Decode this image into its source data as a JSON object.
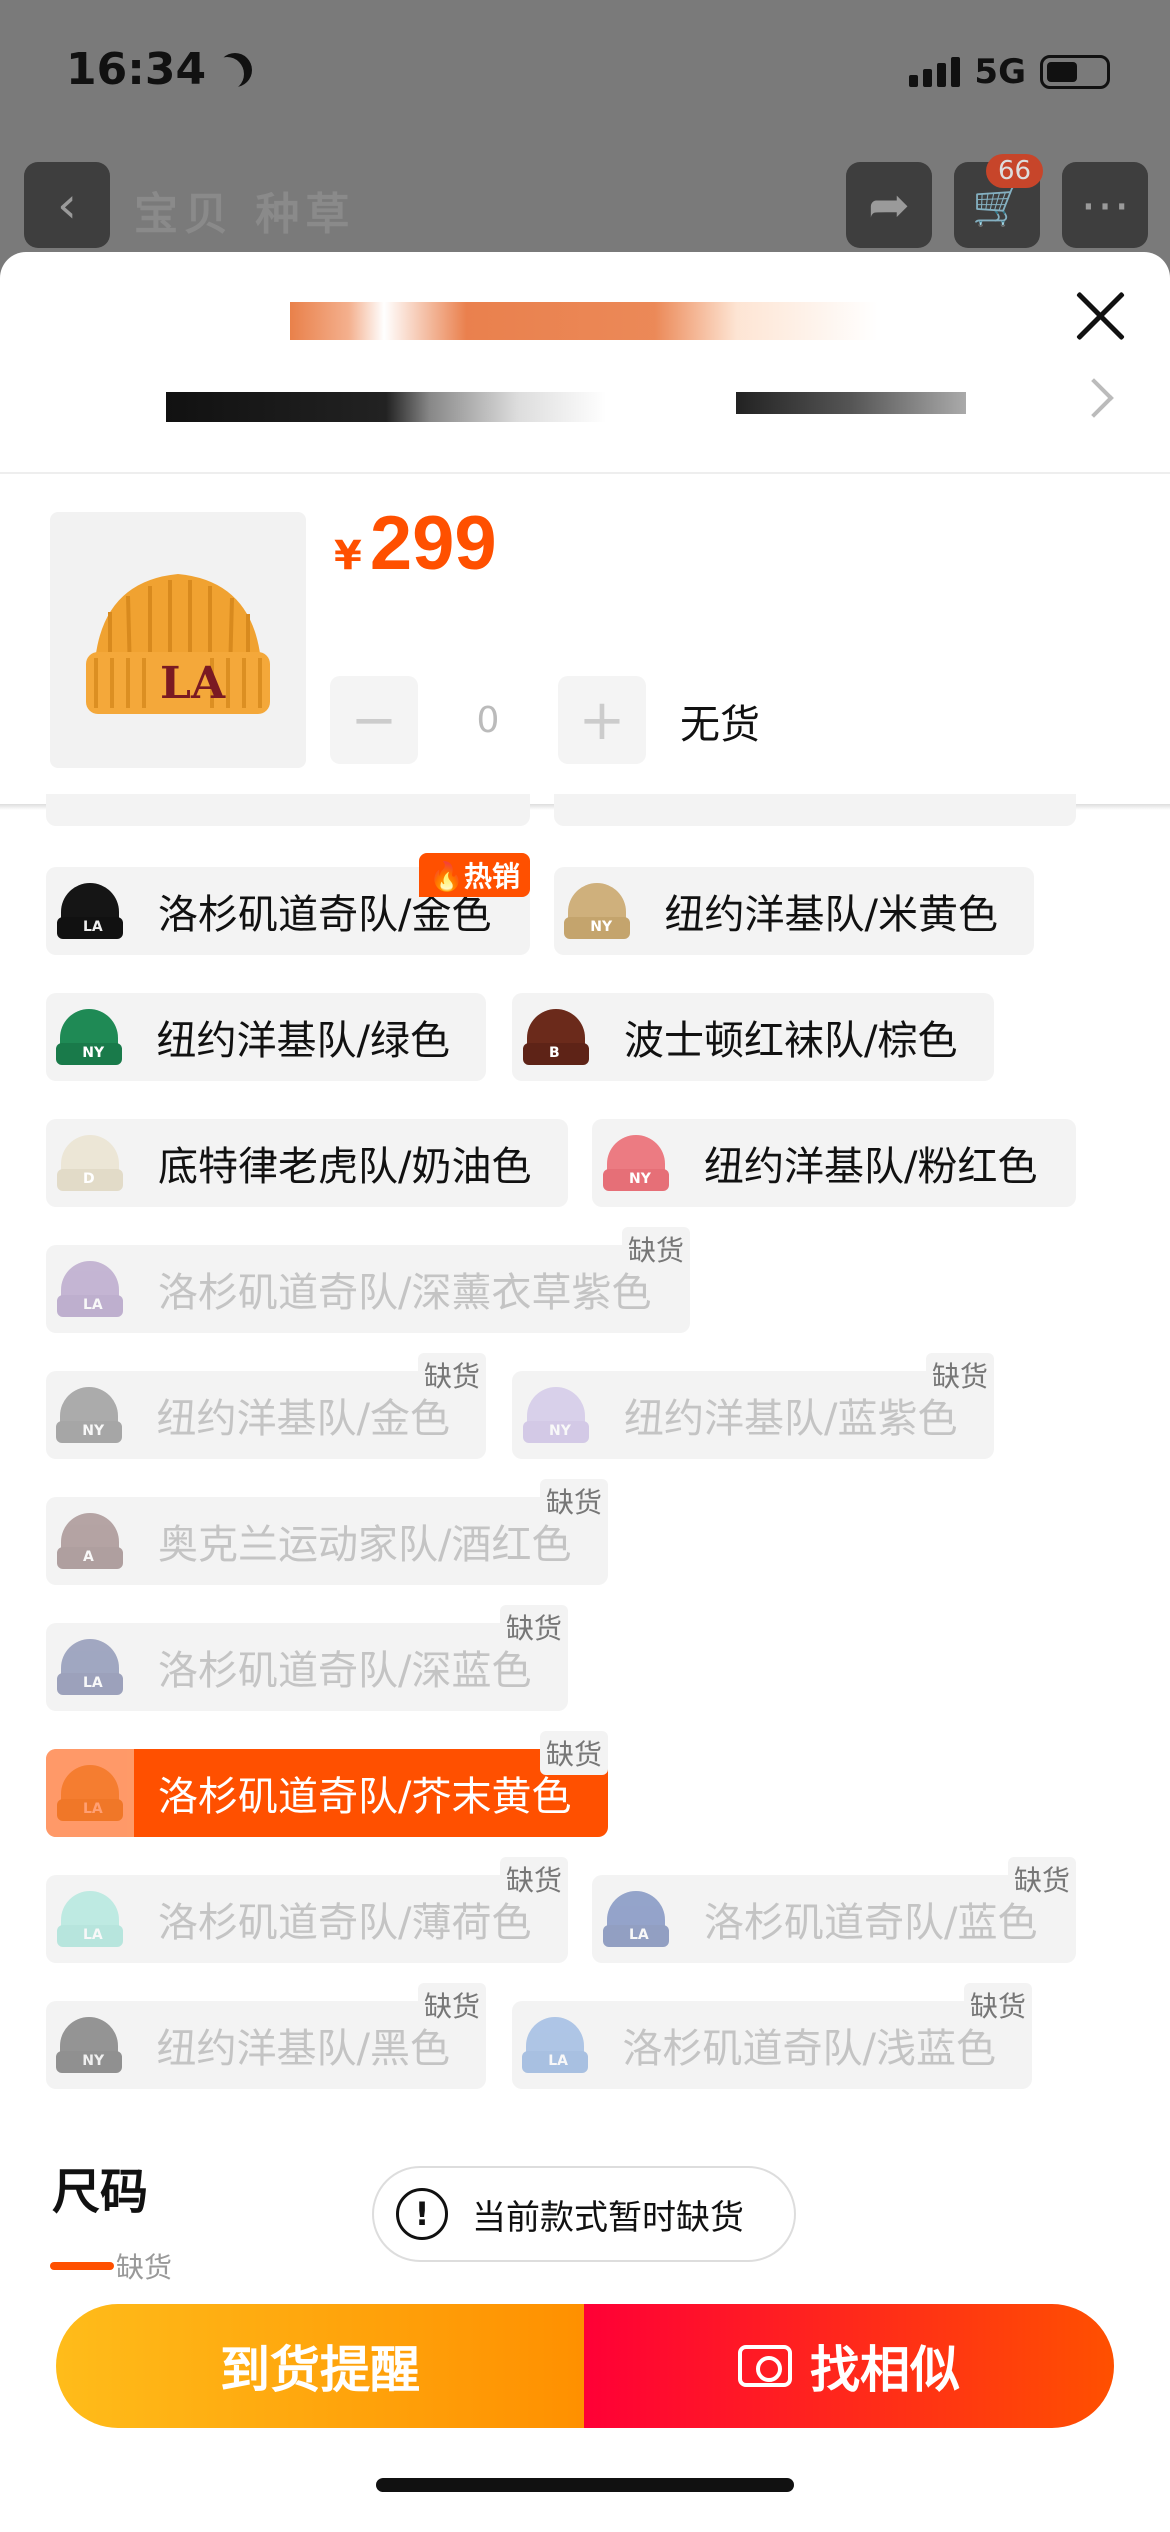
{
  "status_bar": {
    "time": "16:34",
    "network": "5G"
  },
  "background_nav": {
    "title": "宝贝  种草",
    "cart_count": "66"
  },
  "product": {
    "currency": "¥",
    "price": "299",
    "quantity": "0",
    "stock_status": "无货",
    "minus": "−",
    "plus": "+"
  },
  "options": [
    {
      "label": "洛杉矶道奇队/金色",
      "badge": "热销",
      "out_of_stock": false,
      "hat_color": "#151515",
      "cuff_color": "#111",
      "logo": "LA"
    },
    {
      "label": "纽约洋基队/米黄色",
      "badge": "",
      "out_of_stock": false,
      "hat_color": "#cfb07c",
      "cuff_color": "#c4a46d",
      "logo": "NY"
    },
    {
      "label": "纽约洋基队/绿色",
      "badge": "",
      "out_of_stock": false,
      "hat_color": "#1f8a55",
      "cuff_color": "#197a4a",
      "logo": "NY"
    },
    {
      "label": "波士顿红袜队/棕色",
      "badge": "",
      "out_of_stock": false,
      "hat_color": "#6b2a1b",
      "cuff_color": "#5e2317",
      "logo": "B"
    },
    {
      "label": "底特律老虎队/奶油色",
      "badge": "",
      "out_of_stock": false,
      "hat_color": "#ece6d6",
      "cuff_color": "#e2dbc8",
      "logo": "D"
    },
    {
      "label": "纽约洋基队/粉红色",
      "badge": "",
      "out_of_stock": false,
      "hat_color": "#ec7b82",
      "cuff_color": "#e66f77",
      "logo": "NY"
    },
    {
      "label": "洛杉矶道奇队/深薰衣草紫色",
      "badge": "缺货",
      "out_of_stock": true,
      "hat_color": "#8d6cae",
      "cuff_color": "#7f5fa2",
      "logo": "LA"
    },
    {
      "label": "纽约洋基队/金色",
      "badge": "缺货",
      "out_of_stock": true,
      "hat_color": "#555",
      "cuff_color": "#4a4a4a",
      "logo": "NY"
    },
    {
      "label": "纽约洋基队/蓝紫色",
      "badge": "缺货",
      "out_of_stock": true,
      "hat_color": "#b9a6e0",
      "cuff_color": "#ad98d8",
      "logo": "NY"
    },
    {
      "label": "奥克兰运动家队/酒红色",
      "badge": "缺货",
      "out_of_stock": true,
      "hat_color": "#6a4444",
      "cuff_color": "#5d3a3a",
      "logo": "A"
    },
    {
      "label": "洛杉矶道奇队/深蓝色",
      "badge": "缺货",
      "out_of_stock": true,
      "hat_color": "#3d4c86",
      "cuff_color": "#334078",
      "logo": "LA"
    },
    {
      "label": "洛杉矶道奇队/芥末黄色",
      "badge": "缺货",
      "out_of_stock": true,
      "selected": true,
      "hat_color": "#e9b46a",
      "cuff_color": "#e0a85a",
      "logo": "LA"
    },
    {
      "label": "洛杉矶道奇队/薄荷色",
      "badge": "缺货",
      "out_of_stock": true,
      "hat_color": "#7fe0cf",
      "cuff_color": "#70d6c4",
      "logo": "LA"
    },
    {
      "label": "洛杉矶道奇队/蓝色",
      "badge": "缺货",
      "out_of_stock": true,
      "hat_color": "#22449a",
      "cuff_color": "#1d3b89",
      "logo": "LA"
    },
    {
      "label": "纽约洋基队/黑色",
      "badge": "缺货",
      "out_of_stock": true,
      "hat_color": "#222",
      "cuff_color": "#1a1a1a",
      "logo": "NY"
    },
    {
      "label": "洛杉矶道奇队/浅蓝色",
      "badge": "缺货",
      "out_of_stock": true,
      "hat_color": "#5b8fd6",
      "cuff_color": "#4f83cc",
      "logo": "LA"
    }
  ],
  "size_section": {
    "title": "尺码",
    "first_badge": "缺货"
  },
  "toast": {
    "icon": "!",
    "text": "当前款式暂时缺货"
  },
  "actions": {
    "remind": "到货提醒",
    "similar": "找相似"
  },
  "colors": {
    "accent": "#ff5000",
    "remind_start": "#ffbc1a",
    "similar_start": "#ff0036"
  }
}
